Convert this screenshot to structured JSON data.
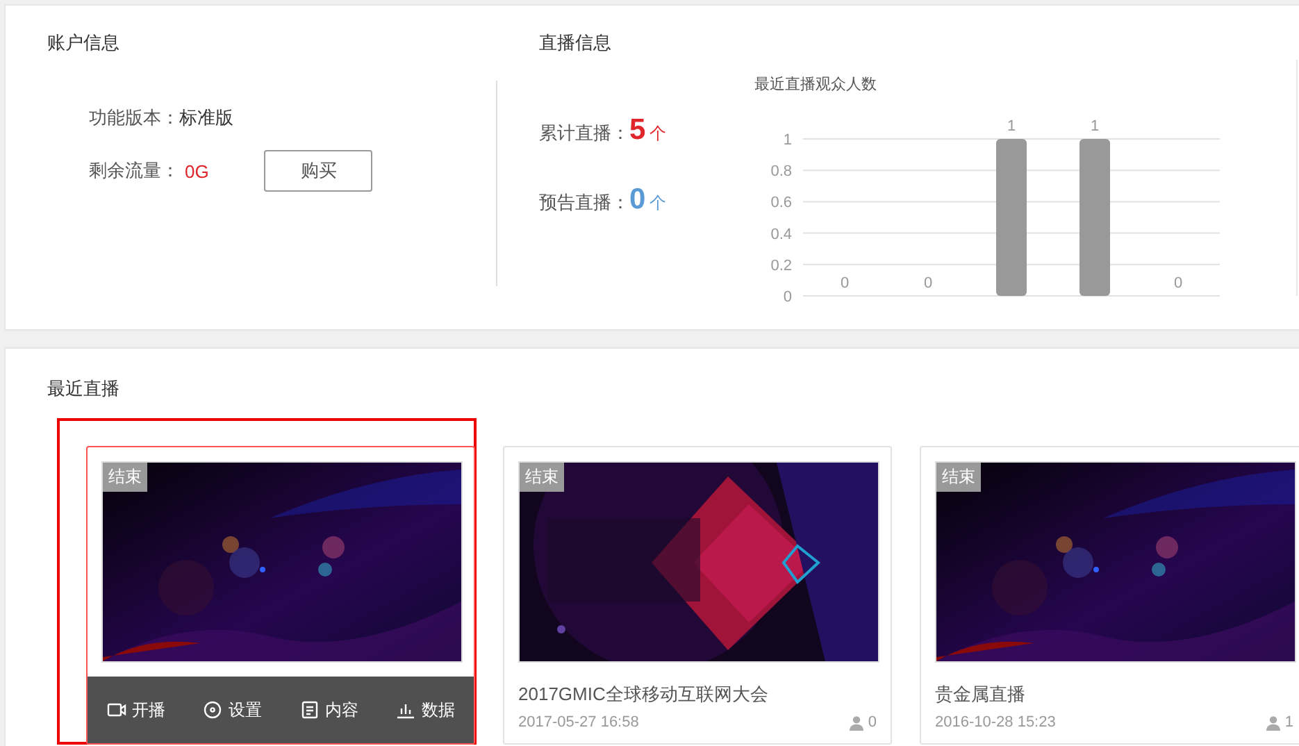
{
  "account": {
    "title": "账户信息",
    "version_label": "功能版本：",
    "version_value": "标准版",
    "traffic_label": "剩余流量：",
    "traffic_value": "0G",
    "buy_button": "购买"
  },
  "live_info": {
    "title": "直播信息",
    "stats": [
      {
        "label": "累计直播：",
        "value": "5",
        "unit": "个",
        "color": "#e0262b"
      },
      {
        "label": "预告直播：",
        "value": "0",
        "unit": "个",
        "color": "#5b9bd5"
      }
    ],
    "chart": {
      "title": "最近直播观众人数",
      "chart_data": {
        "type": "bar",
        "values": [
          0,
          0,
          1,
          1,
          0
        ],
        "ylim": [
          0,
          1
        ],
        "yticks": [
          0,
          0.2,
          0.4,
          0.6,
          0.8,
          1
        ],
        "data_labels": true,
        "grid": true
      }
    }
  },
  "recent": {
    "title": "最近直播",
    "cards": [
      {
        "badge": "结束",
        "hovered": true,
        "highlighted": true,
        "actions": [
          {
            "kind": "start",
            "label": "开播"
          },
          {
            "kind": "settings",
            "label": "设置"
          },
          {
            "kind": "content",
            "label": "内容"
          },
          {
            "kind": "data",
            "label": "数据"
          }
        ]
      },
      {
        "badge": "结束",
        "title": "2017GMIC全球移动互联网大会",
        "date": "2017-05-27 16:58",
        "viewers": "0",
        "hovered": false,
        "highlighted": false
      },
      {
        "badge": "结束",
        "title": "贵金属直播",
        "date": "2016-10-28 15:23",
        "viewers": "1",
        "hovered": false,
        "highlighted": false
      }
    ]
  }
}
